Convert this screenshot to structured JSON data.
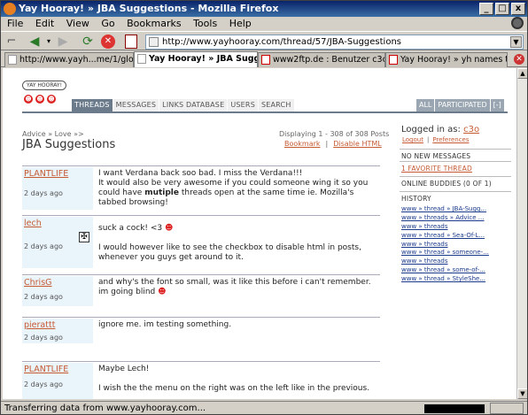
{
  "window": {
    "title": "Yay Hooray! » JBA Suggestions - Mozilla Firefox",
    "minimize": "_",
    "maximize": "□",
    "close": "x"
  },
  "menu": [
    "File",
    "Edit",
    "View",
    "Go",
    "Bookmarks",
    "Tools",
    "Help"
  ],
  "url": "http://www.yayhooray.com/thread/57/JBA-Suggestions",
  "tabs": [
    {
      "label": "http://www.yayh...me/1/global.css"
    },
    {
      "label": "Yay Hooray! » JBA Suggestio..."
    },
    {
      "label": "www2ftp.de : Benutzer c3o verb..."
    },
    {
      "label": "Yay Hooray! » yh names to what..."
    }
  ],
  "status": "Transferring data from www.yayhooray.com...",
  "site": {
    "logo": "YAY HOORAY!",
    "nav": [
      "THREADS",
      "MESSAGES",
      "LINKS DATABASE",
      "USERS",
      "SEARCH"
    ],
    "rightnav": [
      "ALL",
      "PARTICIPATED",
      "[-]"
    ],
    "breadcrumb": "Advice » Love »>",
    "title": "JBA Suggestions",
    "displaying": "Displaying 1 - 308 of 308 Posts",
    "bookmark": "Bookmark",
    "disable_html": "Disable HTML"
  },
  "posts": [
    {
      "author": "PLANTLIFE",
      "time": "2 days ago",
      "lines": [
        "I want Verdana back soo bad. I miss the Verdana!!!",
        "It would also be very awesome if you could someone wing it so you",
        "could have |mutiple| threads open at the same time ie. Mozilla's",
        "tabbed browsing!"
      ]
    },
    {
      "author": "lech",
      "time": "2 days ago",
      "lines": [
        "suck a cock! <3",
        "",
        "I would however like to see the checkbox to disable html in posts,",
        "whenever you guys get around to it."
      ]
    },
    {
      "author": "ChrisG",
      "time": "2 days ago",
      "lines": [
        "and why's the font so small, was it like this before i can't remember.",
        "im going blind"
      ]
    },
    {
      "author": "pierattt",
      "time": "2 days ago",
      "lines": [
        "ignore me. im testing something."
      ]
    },
    {
      "author": "PLANTLIFE",
      "time": "2 days ago",
      "lines": [
        "Maybe Lech!",
        "",
        "I wish the the menu on the right was on the left like in the previous."
      ]
    }
  ],
  "sidebar": {
    "logged_in_label": "Logged in as:",
    "user": "c3o",
    "logout": "Logout",
    "preferences": "Preferences",
    "no_messages": "NO NEW MESSAGES",
    "favorite": "1 FAVORITE THREAD",
    "online": "ONLINE BUDDIES (0 OF 1)",
    "history_label": "HISTORY",
    "history": [
      "www » thread » JBA-Sugg...",
      "www » threads » Advice ...",
      "www » threads",
      "www » thread » Sea-Of-L...",
      "www » threads",
      "www » thread » someone-...",
      "www » threads",
      "www » thread » some-of-...",
      "www » thread » StyleShe..."
    ]
  }
}
